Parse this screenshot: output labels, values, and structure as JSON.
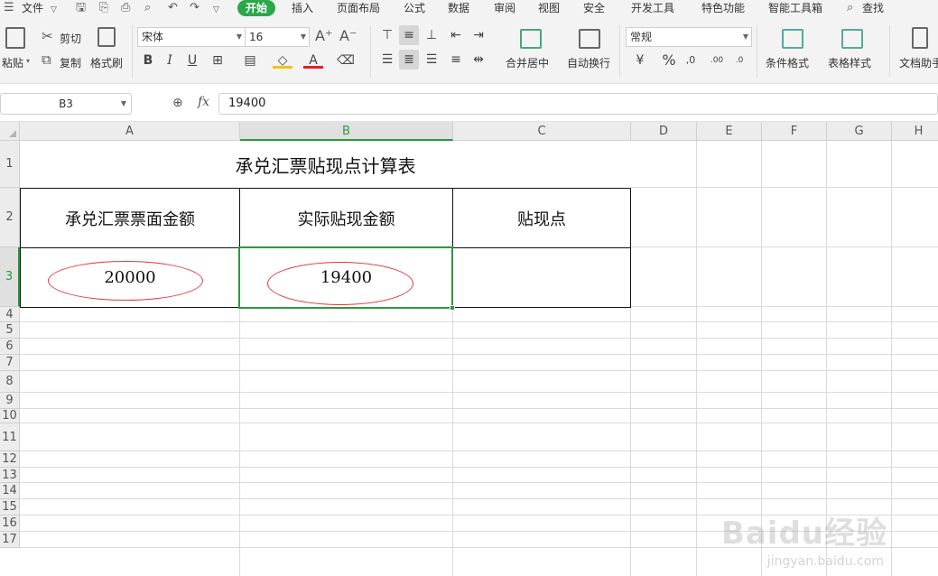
{
  "menubar": {
    "file_label": "文件",
    "tabs": [
      "开始",
      "插入",
      "页面布局",
      "公式",
      "数据",
      "审阅",
      "视图",
      "安全",
      "开发工具",
      "特色功能",
      "智能工具箱"
    ],
    "active_tab": "开始",
    "search_label": "查找",
    "accent_color": "#2aa84a"
  },
  "ribbon": {
    "paste_label": "粘贴",
    "cut_label": "剪切",
    "copy_label": "复制",
    "format_painter_label": "格式刷",
    "font_name": "宋体",
    "font_size": "16",
    "bold": "B",
    "italic": "I",
    "underline": "U",
    "font_color_glyph": "A",
    "merge_center_label": "合并居中",
    "wrap_text_label": "自动换行",
    "number_format": "常规",
    "percent_glyph": "%",
    "conditional_format_label": "条件格式",
    "table_style_label": "表格样式",
    "doc_assistant_label": "文档助手",
    "font_grow_glyph": "A⁺",
    "font_shrink_glyph": "A⁻"
  },
  "formula_bar": {
    "cell_ref": "B3",
    "fx_label": "fx",
    "value": "19400"
  },
  "sheet": {
    "columns": [
      "A",
      "B",
      "C",
      "D",
      "E",
      "F",
      "G",
      "H"
    ],
    "selected_column": "B",
    "rows": [
      "1",
      "2",
      "3",
      "4",
      "5",
      "6",
      "7",
      "8",
      "9",
      "10",
      "11",
      "12",
      "13",
      "14",
      "15",
      "16",
      "17"
    ],
    "selected_row": "3",
    "title": "承兑汇票贴现点计算表",
    "headers": [
      "承兑汇票票面金额",
      "实际贴现金额",
      "贴现点"
    ],
    "values": [
      "20000",
      "19400",
      ""
    ],
    "selected_cell": "B3",
    "highlight_color": "#e0373a"
  },
  "watermark": {
    "main": "Baidu经验",
    "sub": "jingyan.baidu.com"
  }
}
